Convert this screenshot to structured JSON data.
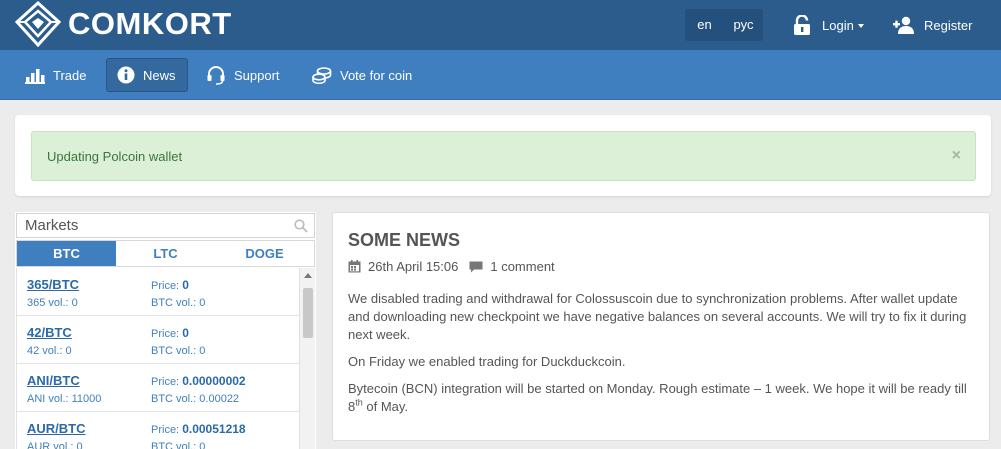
{
  "header": {
    "logo_text": "COMKORT",
    "languages": [
      "en",
      "рус"
    ],
    "login_label": "Login",
    "register_label": "Register"
  },
  "nav": {
    "items": [
      {
        "label": "Trade",
        "icon": "bar-chart-icon"
      },
      {
        "label": "News",
        "icon": "info-icon",
        "active": true
      },
      {
        "label": "Support",
        "icon": "headset-icon"
      },
      {
        "label": "Vote for coin",
        "icon": "coins-icon"
      }
    ]
  },
  "alert": {
    "text": "Updating Polcoin wallet",
    "close": "×"
  },
  "markets": {
    "search_value": "Markets",
    "tabs": [
      "BTC",
      "LTC",
      "DOGE"
    ],
    "active_tab": "BTC",
    "price_label": "Price:",
    "rows": [
      {
        "pair": "365/BTC",
        "volume": "365 vol.: 0",
        "price": "0",
        "btc_volume": "BTC vol.: 0"
      },
      {
        "pair": "42/BTC",
        "volume": "42 vol.: 0",
        "price": "0",
        "btc_volume": "BTC vol.: 0"
      },
      {
        "pair": "ANI/BTC",
        "volume": "ANI vol.: 11000",
        "price": "0.00000002",
        "btc_volume": "BTC vol.: 0.00022"
      },
      {
        "pair": "AUR/BTC",
        "volume": "AUR vol.: 0",
        "price": "0.00051218",
        "btc_volume": "BTC vol.: 0"
      }
    ]
  },
  "news": {
    "title": "SOME NEWS",
    "date": "26th April 15:06",
    "comments": "1 comment",
    "paragraph1": "We disabled trading and withdrawal for Colossuscoin due to synchronization problems. After wallet update and downloading new checkpoint we have negative balances on several accounts. We will try to fix it during next week.",
    "paragraph2": "On Friday we enabled trading for Duckduckcoin.",
    "paragraph3_start": "Bytecoin (BCN) integration will be started on Monday. Rough estimate – 1 week. We hope it will be ready till 8",
    "paragraph3_sup": "th",
    "paragraph3_end": " of May."
  },
  "colors": {
    "header_bg": "#2b5c8c",
    "nav_bg": "#3f7fc0",
    "alert_bg": "#dcefd7",
    "alert_text": "#3c763d",
    "link": "#2b6aa8"
  }
}
